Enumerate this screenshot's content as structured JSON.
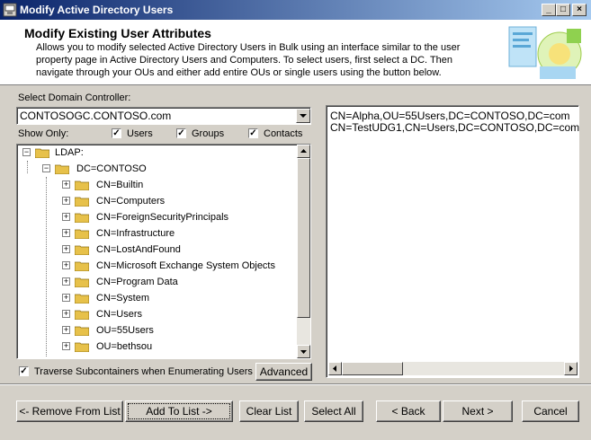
{
  "window": {
    "title": "Modify Active Directory Users"
  },
  "header": {
    "title": "Modify Existing User Attributes",
    "description": "Allows you to modify selected Active Directory Users in Bulk using an interface similar to the user property page in Active Directory Users and Computers.  To select users, first select a DC.  Then navigate through your OUs and either add entire OUs or single users using the button below."
  },
  "domain_controller": {
    "label": "Select Domain Controller:",
    "value": "CONTOSOGC.CONTOSO.com"
  },
  "show_only": {
    "label": "Show Only:",
    "users": "Users",
    "groups": "Groups",
    "contacts": "Contacts"
  },
  "tree": {
    "root": "LDAP:",
    "domain": "DC=CONTOSO",
    "children": [
      "CN=Builtin",
      "CN=Computers",
      "CN=ForeignSecurityPrincipals",
      "CN=Infrastructure",
      "CN=LostAndFound",
      "CN=Microsoft Exchange System Objects",
      "CN=Program Data",
      "CN=System",
      "CN=Users",
      "OU=55Users",
      "OU=bethsou"
    ]
  },
  "traverse": {
    "label": "Traverse Subcontainers when Enumerating Users"
  },
  "advanced_label": "Advanced",
  "selected_list": [
    "CN=Alpha,OU=55Users,DC=CONTOSO,DC=com",
    "CN=TestUDG1,CN=Users,DC=CONTOSO,DC=com"
  ],
  "buttons": {
    "remove": "<- Remove From List",
    "add": "Add To List ->",
    "clear": "Clear List",
    "select_all": "Select All",
    "back": "< Back",
    "next": "Next >",
    "cancel": "Cancel"
  }
}
